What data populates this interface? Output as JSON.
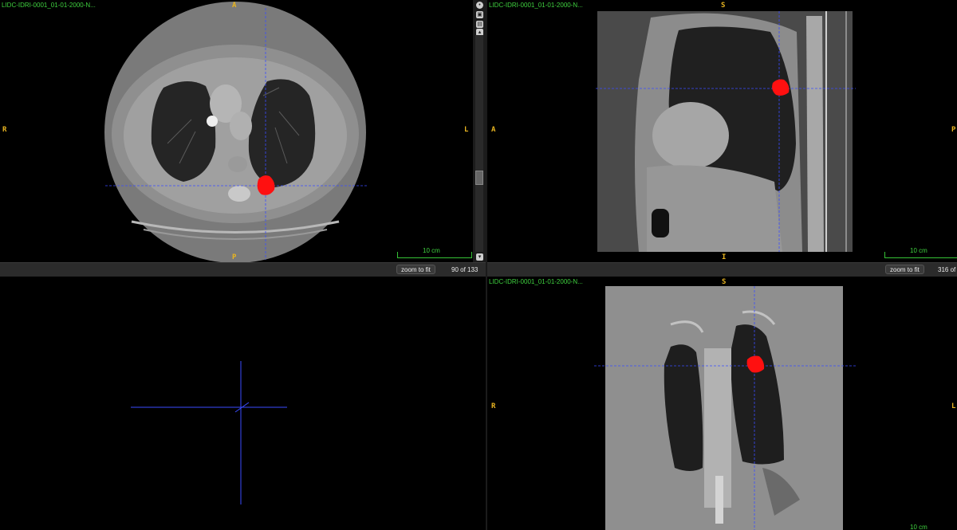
{
  "colors": {
    "series_label": "#3fd23f",
    "orientation": "#e8b420",
    "crosshair": "#3a4cff",
    "lesion": "#ff1010",
    "toolbar_bg": "#2b2b2b"
  },
  "axial": {
    "series_label": "LIDC-IDRI-0001_01-01-2000-N...",
    "orient_top": "A",
    "orient_bottom": "P",
    "orient_left": "R",
    "orient_right": "L",
    "scale_label": "10 cm"
  },
  "sagittal": {
    "series_label": "LIDC-IDRI-0001_01-01-2000-N...",
    "orient_top": "S",
    "orient_bottom": "I",
    "orient_left": "A",
    "orient_right": "P",
    "scale_label": "10 cm"
  },
  "coronal": {
    "series_label": "LIDC-IDRI-0001_01-01-2000-N...",
    "orient_top": "S",
    "orient_left": "R",
    "orient_right": "L",
    "scale_label": "10 cm"
  },
  "toolbar": {
    "zoom_to_fit_label": "zoom to fit",
    "axial_slice": "90 of 133",
    "sagittal_slice": "316 of"
  },
  "icons": {
    "side_top": "circle-dot-icon",
    "side_2": "orientation-cube-icon",
    "side_3": "grid-icon",
    "side_4": "scroll-up-icon",
    "side_5": "scroll-down-icon"
  }
}
